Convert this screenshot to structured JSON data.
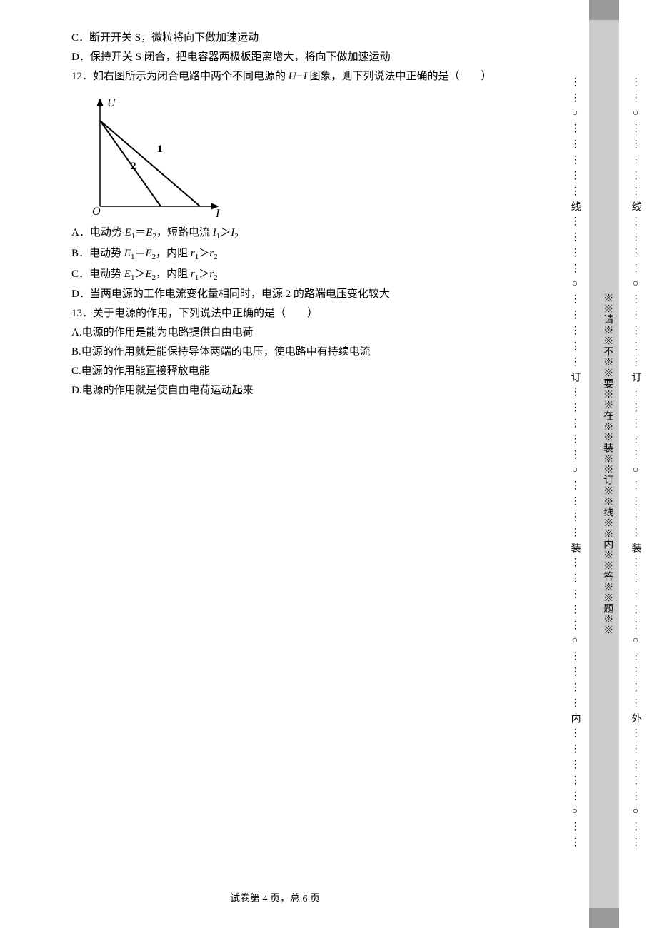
{
  "lead_options": {
    "c": "C．断开开关 S，微粒将向下做加速运动",
    "d": "D．保持开关 S 闭合，把电容器两极板距离增大，将向下做加速运动"
  },
  "q12": {
    "stem_pre": "12．如右图所示为闭合电路中两个不同电源的 ",
    "stem_mid": "U−I",
    "stem_post": " 图象，则下列说法中正确的是（　　）",
    "graph": {
      "y_label": "U",
      "x_label": "I",
      "origin": "O",
      "series1": "1",
      "series2": "2"
    },
    "options": {
      "a_pre": "A．电动势 ",
      "a_e1": "E",
      "a_e1s": "1",
      "a_mid1": "＝",
      "a_e2": "E",
      "a_e2s": "2",
      "a_mid2": "，短路电流 ",
      "a_i1": "I",
      "a_i1s": "1",
      "a_gt": "＞",
      "a_i2": "I",
      "a_i2s": "2",
      "b_pre": "B．电动势 ",
      "b_e1": "E",
      "b_e1s": "1",
      "b_mid1": "＝",
      "b_e2": "E",
      "b_e2s": "2",
      "b_mid2": "，内阻 ",
      "b_r1": "r",
      "b_r1s": "1",
      "b_gt": "＞",
      "b_r2": "r",
      "b_r2s": "2",
      "c_pre": "C．电动势 ",
      "c_e1": "E",
      "c_e1s": "1",
      "c_mid1": "＞",
      "c_e2": "E",
      "c_e2s": "2",
      "c_mid2": "，内阻 ",
      "c_r1": "r",
      "c_r1s": "1",
      "c_gt": "＞",
      "c_r2": "r",
      "c_r2s": "2",
      "d": "D．当两电源的工作电流变化量相同时，电源 2 的路端电压变化较大"
    }
  },
  "q13": {
    "stem": "13．关于电源的作用，下列说法中正确的是（　　）",
    "a": "A.电源的作用是能为电路提供自由电荷",
    "b": "B.电源的作用就是能保持导体两端的电压，使电路中有持续电流",
    "c": "C.电源的作用能直接释放电能",
    "d": "D.电源的作用就是使自由电荷运动起来"
  },
  "footer": "试卷第 4 页，总 6 页",
  "binding": {
    "inner_seq": "⋮⋮○⋮⋮⋮⋮⋮线⋮⋮⋮⋮○⋮⋮⋮⋮⋮订⋮⋮⋮⋮⋮○⋮⋮⋮⋮装⋮⋮⋮⋮⋮○⋮⋮⋮⋮内⋮⋮⋮⋮⋮○⋮⋮",
    "outer_seq": "⋮⋮○⋮⋮⋮⋮⋮线⋮⋮⋮⋮○⋮⋮⋮⋮⋮订⋮⋮⋮⋮⋮○⋮⋮⋮⋮装⋮⋮⋮⋮⋮○⋮⋮⋮⋮外⋮⋮⋮⋮⋮○⋮⋮",
    "advice": "※※请※※不※※要※※在※※装※※订※※线※※内※※答※※题※※"
  },
  "chart_data": {
    "type": "line",
    "title": "",
    "xlabel": "I",
    "ylabel": "U",
    "origin_label": "O",
    "xlim": [
      0,
      10
    ],
    "ylim": [
      0,
      10
    ],
    "series": [
      {
        "name": "1",
        "x": [
          0,
          8.5
        ],
        "y": [
          8,
          0
        ]
      },
      {
        "name": "2",
        "x": [
          0,
          5.5
        ],
        "y": [
          8,
          0
        ]
      }
    ],
    "note": "Both lines share same y-intercept (same EMF). Line 1 reaches a larger x-intercept (larger short-circuit current) than line 2; line 2 is steeper (larger internal resistance)."
  }
}
